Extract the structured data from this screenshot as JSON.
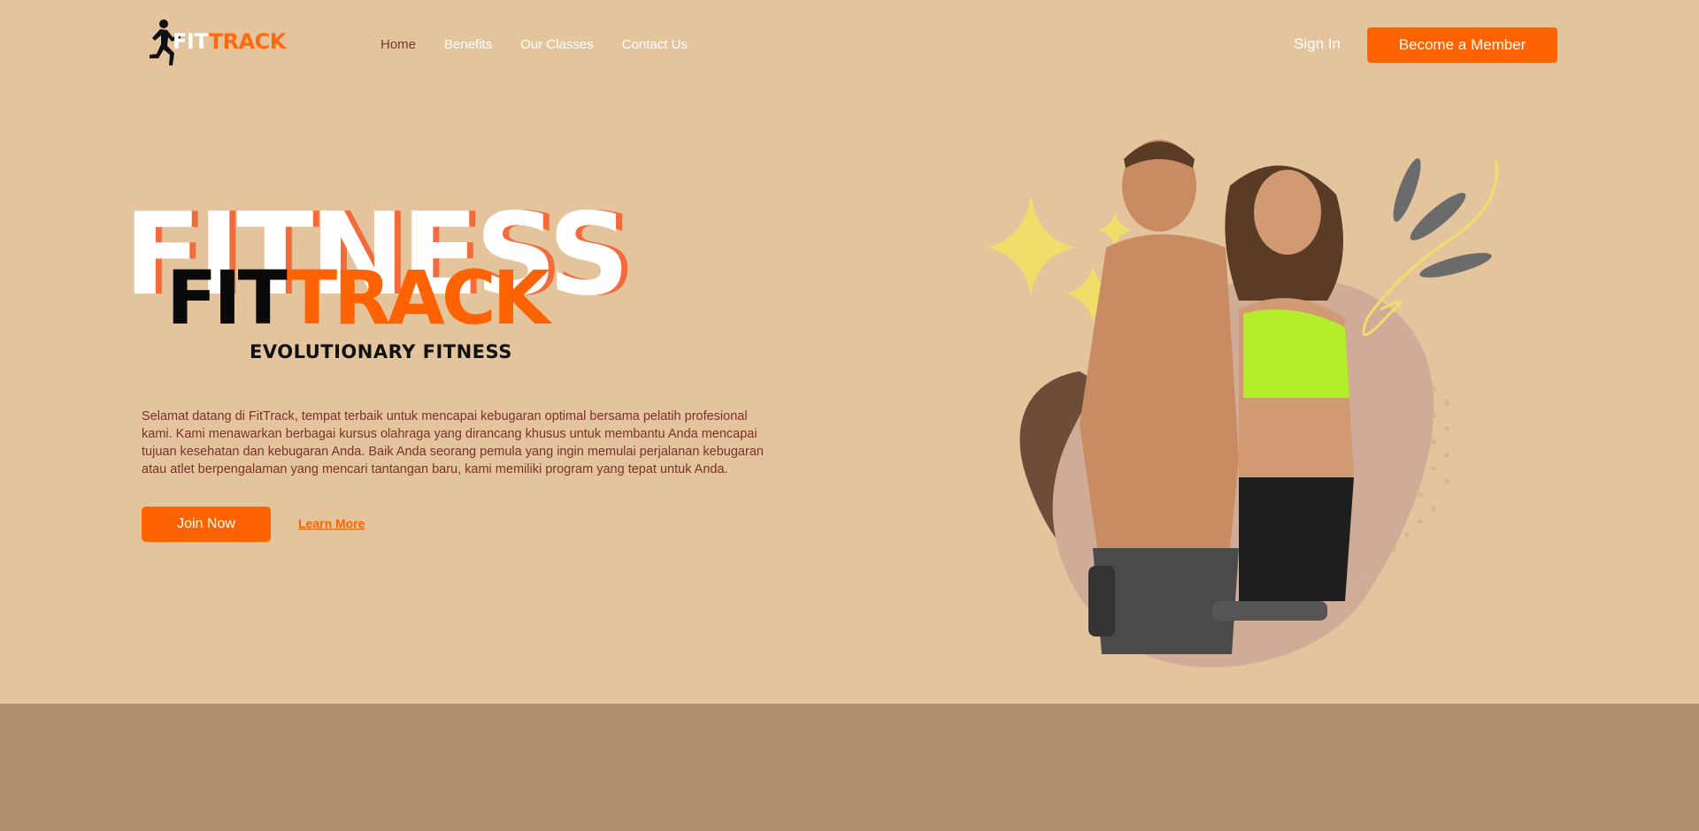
{
  "brand": {
    "logo_fit": "FIT",
    "logo_track": "TRACK"
  },
  "nav": {
    "links": [
      {
        "label": "Home",
        "active": true
      },
      {
        "label": "Benefits",
        "active": false
      },
      {
        "label": "Our Classes",
        "active": false
      },
      {
        "label": "Contact Us",
        "active": false
      }
    ],
    "sign_in": "Sign In",
    "member_button": "Become a Member"
  },
  "hero": {
    "background_word": "FITNESS",
    "title_fit": "FIT",
    "title_track": "TRACK",
    "tagline": "EVOLUTIONARY FITNESS",
    "description": "Selamat datang di FitTrack, tempat terbaik untuk mencapai kebugaran optimal bersama pelatih profesional kami. Kami menawarkan berbagai kursus olahraga yang dirancang khusus untuk membantu Anda mencapai tujuan kesehatan dan kebugaran Anda. Baik Anda seorang pemula yang ingin memulai perjalanan kebugaran atau atlet berpengalaman yang mencari tantangan baru, kami memiliki program yang tepat untuk Anda.",
    "join_button": "Join Now",
    "learn_more": "Learn More"
  },
  "colors": {
    "background": "#e4c49d",
    "accent": "#ff6200",
    "bottom_band": "#b08f6f",
    "text_brown": "#7a3326"
  }
}
